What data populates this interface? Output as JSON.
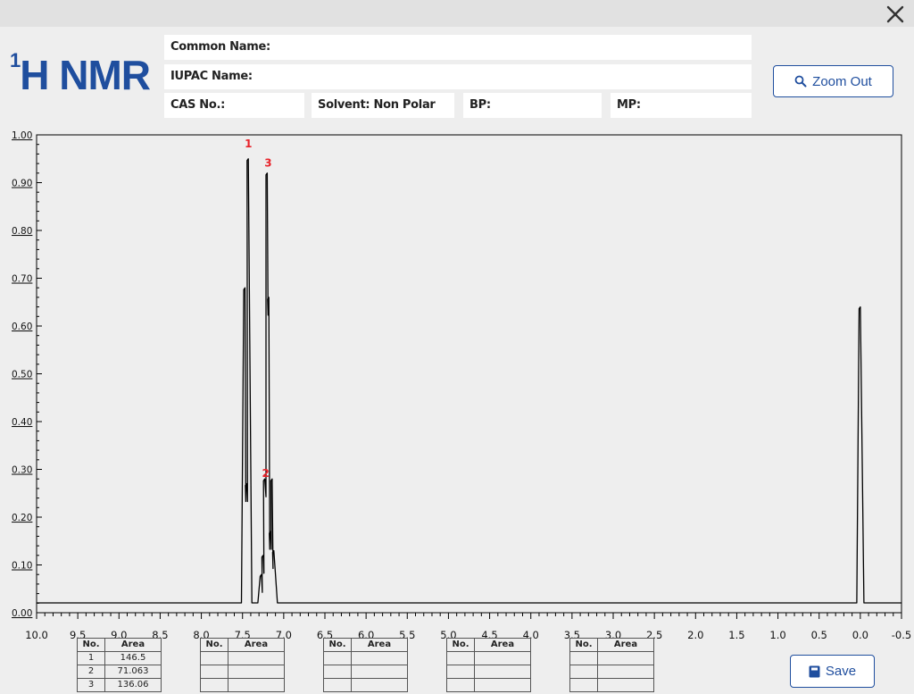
{
  "header": {
    "logo_sup": "1",
    "logo_text": "H NMR",
    "close_icon": "close-icon"
  },
  "fields": {
    "common_name": "Common Name:",
    "iupac_name": "IUPAC Name:",
    "cas_no": "CAS No.:",
    "solvent": "Solvent: Non Polar",
    "bp": "BP:",
    "mp": "MP:"
  },
  "buttons": {
    "zoom_out_label": "Zoom Out",
    "zoom_out_icon": "magnifier-icon",
    "save_label": "Save",
    "save_icon": "save-icon"
  },
  "colors": {
    "brand": "#1f4e9e",
    "peak_label": "#e8232a",
    "spectrum": "#000000"
  },
  "chart_data": {
    "type": "line",
    "xlabel": "",
    "ylabel": "",
    "xlim": [
      10.0,
      -0.5
    ],
    "ylim": [
      0,
      1.0
    ],
    "x_reversed": true,
    "grid": false,
    "x_ticks": [
      "10.0",
      "9.5",
      "9.0",
      "8.5",
      "8.0",
      "7.5",
      "7.0",
      "6.5",
      "6.0",
      "5.5",
      "5.0",
      "4.5",
      "4.0",
      "3.5",
      "3.0",
      "2.5",
      "2.0",
      "1.5",
      "1.0",
      "0.5",
      "0.0",
      "-0.5"
    ],
    "y_ticks": [
      "0.00",
      "0.10",
      "0.20",
      "0.30",
      "0.40",
      "0.50",
      "0.60",
      "0.70",
      "0.80",
      "0.90",
      "1.00"
    ],
    "series": [
      {
        "points": [
          [
            7.47,
            0.68
          ],
          [
            7.45,
            0.27
          ],
          [
            7.43,
            0.95
          ],
          [
            7.27,
            0.08
          ],
          [
            7.25,
            0.12
          ],
          [
            7.23,
            0.28
          ],
          [
            7.2,
            0.92
          ],
          [
            7.18,
            0.66
          ],
          [
            7.16,
            0.17
          ],
          [
            7.14,
            0.28
          ],
          [
            7.12,
            0.13
          ],
          [
            0.0,
            0.64
          ]
        ]
      }
    ],
    "peak_labels": [
      {
        "text": "1",
        "x": 7.44,
        "y": 0.97
      },
      {
        "text": "2",
        "x": 7.23,
        "y": 0.28
      },
      {
        "text": "3",
        "x": 7.2,
        "y": 0.93
      }
    ]
  },
  "peak_tables": [
    {
      "header_no": "No.",
      "header_area": "Area",
      "rows": [
        [
          "1",
          "146.5"
        ],
        [
          "2",
          "71.063"
        ],
        [
          "3",
          "136.06"
        ]
      ]
    },
    {
      "header_no": "No.",
      "header_area": "Area",
      "rows": [
        [
          "",
          ""
        ],
        [
          "",
          ""
        ],
        [
          "",
          ""
        ]
      ]
    },
    {
      "header_no": "No.",
      "header_area": "Area",
      "rows": [
        [
          "",
          ""
        ],
        [
          "",
          ""
        ],
        [
          "",
          ""
        ]
      ]
    },
    {
      "header_no": "No.",
      "header_area": "Area",
      "rows": [
        [
          "",
          ""
        ],
        [
          "",
          ""
        ],
        [
          "",
          ""
        ]
      ]
    },
    {
      "header_no": "No.",
      "header_area": "Area",
      "rows": [
        [
          "",
          ""
        ],
        [
          "",
          ""
        ],
        [
          "",
          ""
        ]
      ]
    }
  ]
}
